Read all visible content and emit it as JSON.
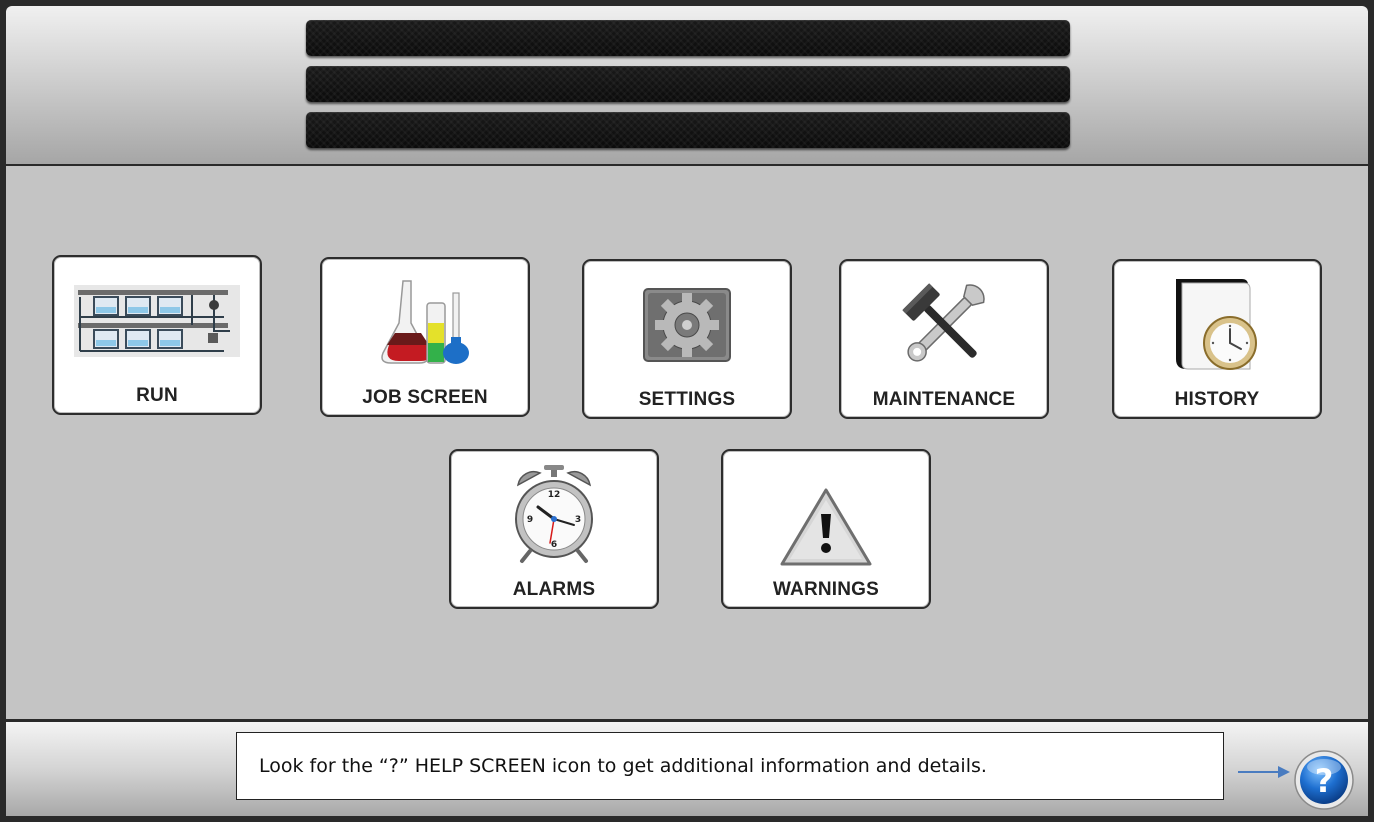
{
  "header": {
    "status_lines": [
      "",
      "",
      ""
    ]
  },
  "menu": {
    "row1": [
      {
        "id": "run",
        "label": "RUN",
        "icon": "machine-icon"
      },
      {
        "id": "job-screen",
        "label": "JOB SCREEN",
        "icon": "beakers-icon"
      },
      {
        "id": "settings",
        "label": "SETTINGS",
        "icon": "gear-icon"
      },
      {
        "id": "maintenance",
        "label": "MAINTENANCE",
        "icon": "wrench-hammer-icon"
      },
      {
        "id": "history",
        "label": "HISTORY",
        "icon": "folder-clock-icon"
      }
    ],
    "row2": [
      {
        "id": "alarms",
        "label": "ALARMS",
        "icon": "alarm-clock-icon"
      },
      {
        "id": "warnings",
        "label": "WARNINGS",
        "icon": "warning-triangle-icon"
      }
    ]
  },
  "footer": {
    "callout_text": "Look for the “?” HELP SCREEN icon to get additional information and details.",
    "help_button_glyph": "?",
    "help_icon": "question-mark-icon"
  },
  "colors": {
    "panel": "#c4c4c4",
    "help_blue": "#1e6fd0",
    "arrow": "#4a7cc0"
  }
}
